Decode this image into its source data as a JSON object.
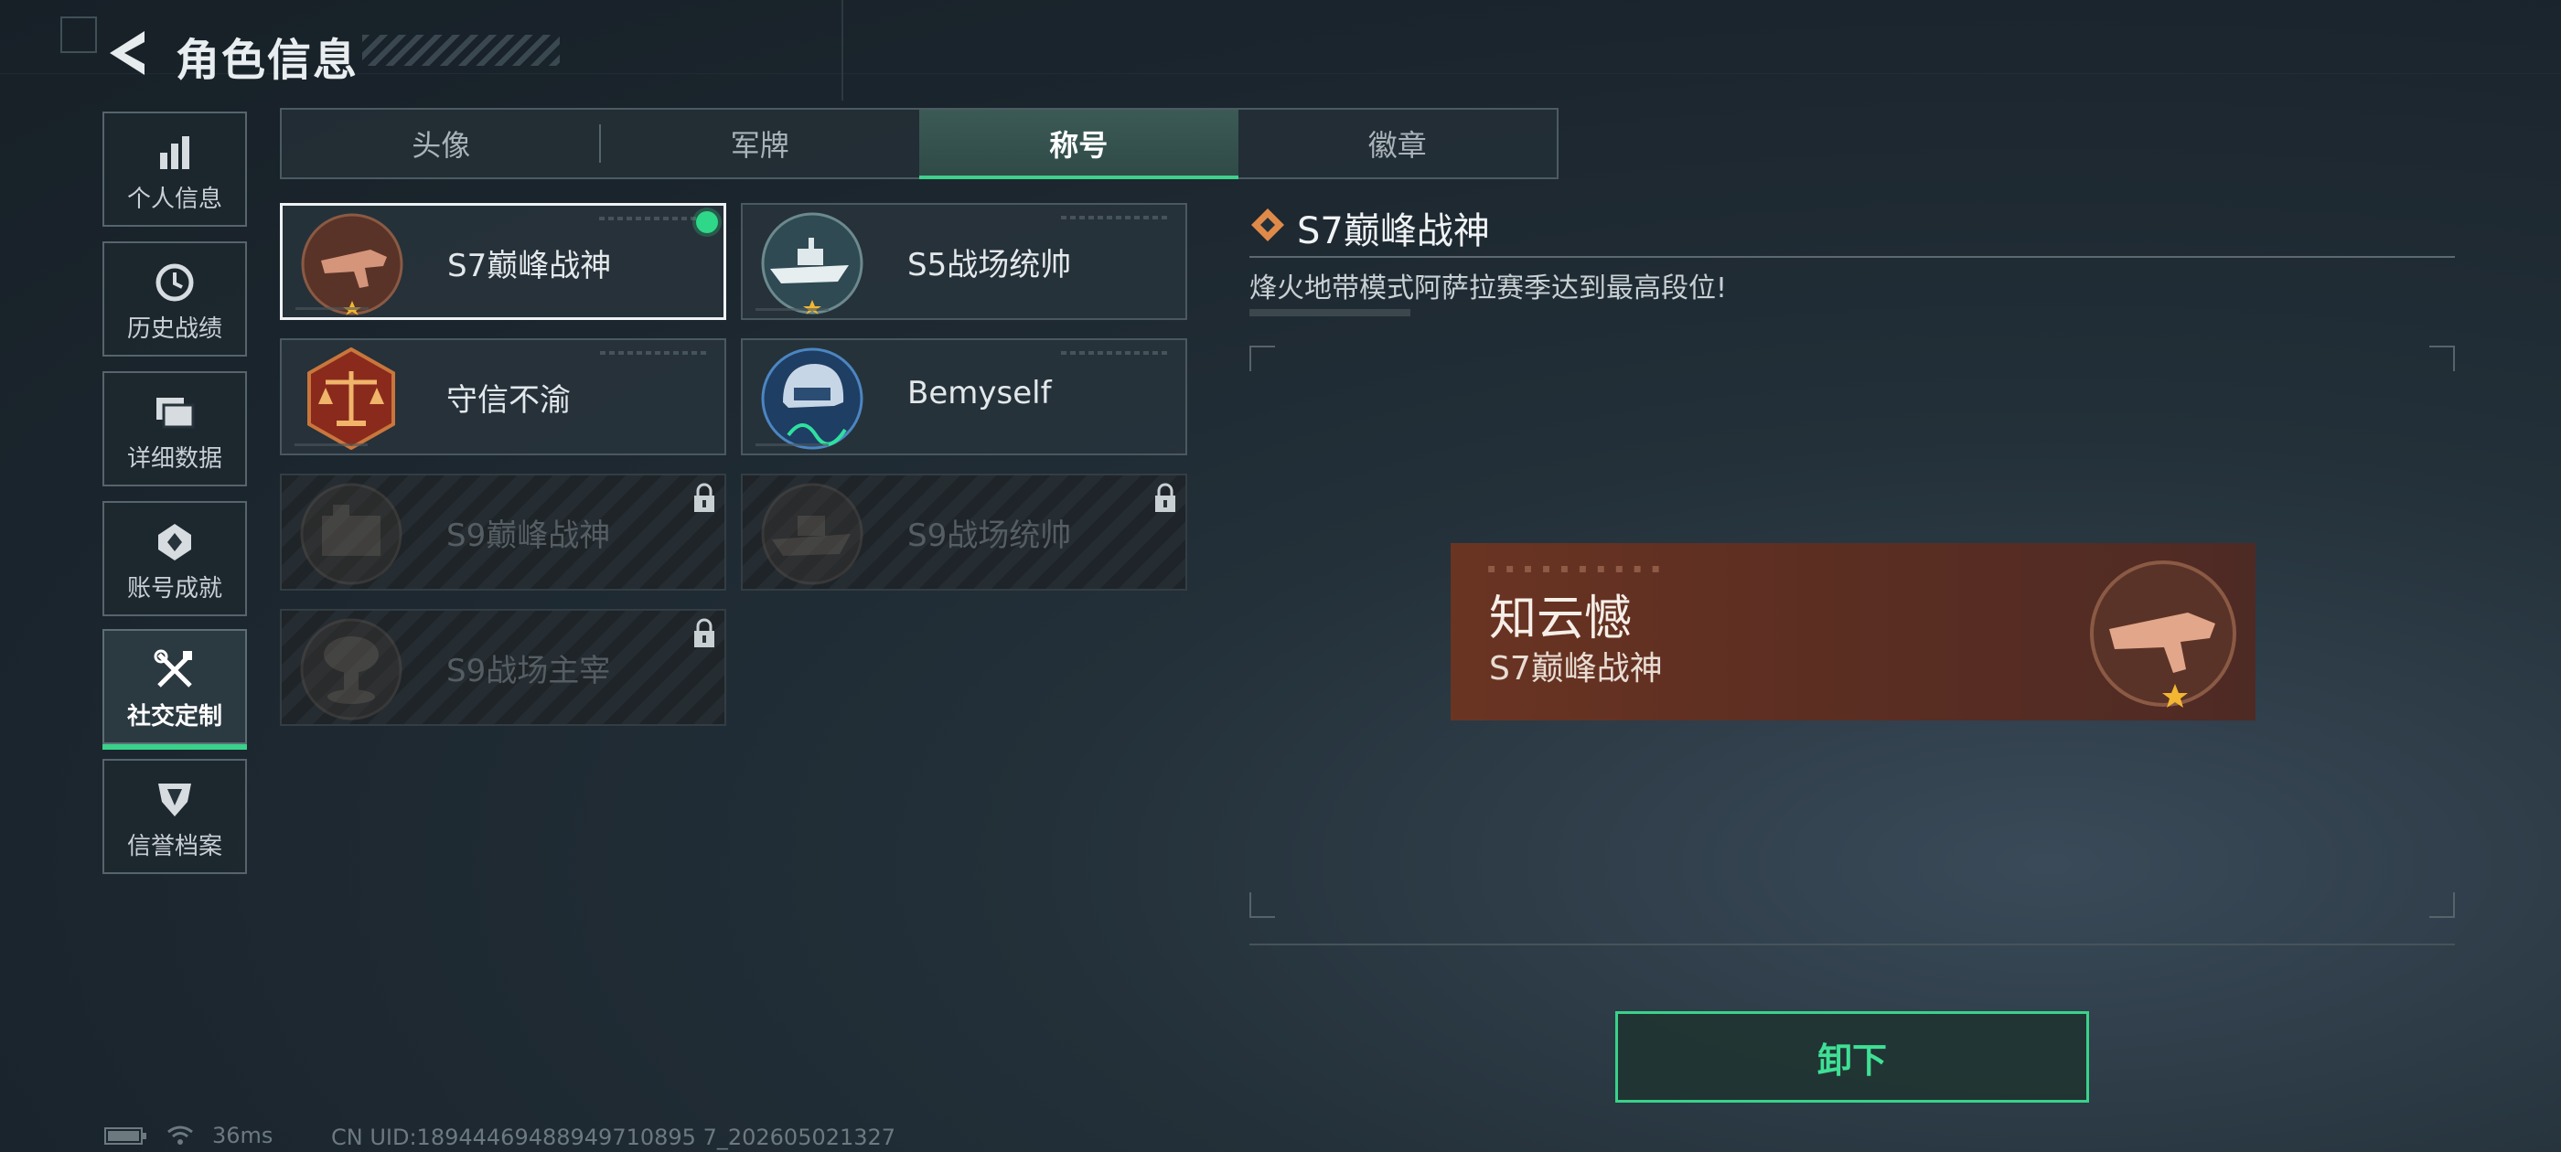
{
  "header": {
    "title": "角色信息"
  },
  "sidebar": {
    "items": [
      {
        "label": "个人信息",
        "icon": "bar-chart-icon"
      },
      {
        "label": "历史战绩",
        "icon": "history-clock-icon"
      },
      {
        "label": "详细数据",
        "icon": "folder-icon"
      },
      {
        "label": "账号成就",
        "icon": "achievement-badge-icon"
      },
      {
        "label": "社交定制",
        "icon": "tools-icon",
        "active": true
      },
      {
        "label": "信誉档案",
        "icon": "shield-record-icon"
      }
    ]
  },
  "tabs": [
    {
      "label": "头像"
    },
    {
      "label": "军牌"
    },
    {
      "label": "称号",
      "active": true
    },
    {
      "label": "徽章"
    }
  ],
  "titles": [
    {
      "name": "S7巅峰战神",
      "emblem": "crossbow-emblem-icon",
      "selected": true,
      "equipped": true,
      "locked": false
    },
    {
      "name": "S5战场统帅",
      "emblem": "warship-emblem-icon",
      "selected": false,
      "locked": false
    },
    {
      "name": "守信不渝",
      "emblem": "scales-emblem-icon",
      "selected": false,
      "locked": false
    },
    {
      "name": "Bemyself",
      "emblem": "helmet-emblem-icon",
      "selected": false,
      "locked": false
    },
    {
      "name": "S9巅峰战神",
      "emblem": "fortress-emblem-icon",
      "locked": true
    },
    {
      "name": "S9战场统帅",
      "emblem": "battleship-emblem-icon",
      "locked": true
    },
    {
      "name": "S9战场主宰",
      "emblem": "mushroom-cloud-emblem-icon",
      "locked": true
    }
  ],
  "detail": {
    "title": "S7巅峰战神",
    "description": "烽火地带模式阿萨拉赛季达到最高段位!",
    "preview": {
      "player_name": "知云憾",
      "title": "S7巅峰战神"
    },
    "button_label": "卸下"
  },
  "footer": {
    "ping": "36ms",
    "uid": "CN UID:18944469488949710895 7_202605021327"
  },
  "colors": {
    "accent": "#39d28a",
    "preview_bg": "#6a3422",
    "star": "#f2b632"
  }
}
